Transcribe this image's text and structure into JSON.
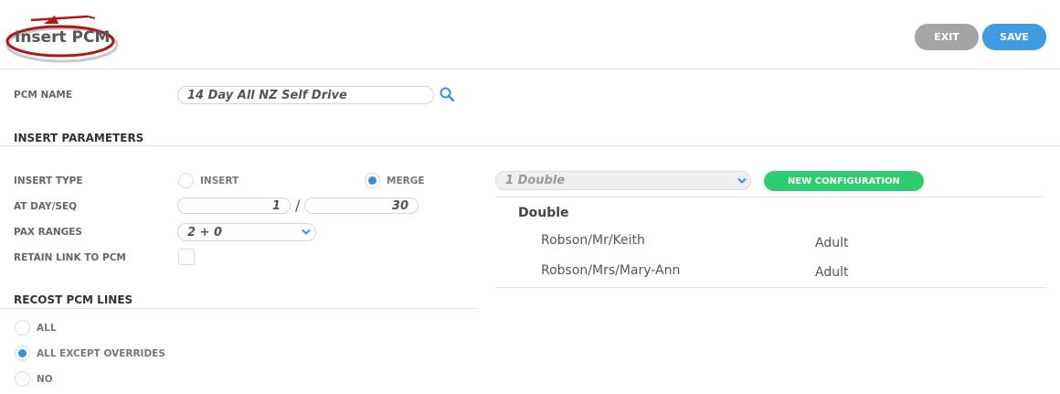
{
  "header": {
    "title": "Insert PCM",
    "exit_label": "EXIT",
    "save_label": "SAVE"
  },
  "pcm_name": {
    "label": "PCM NAME",
    "value": "14 Day All NZ Self Drive"
  },
  "insert_parameters": {
    "heading": "INSERT PARAMETERS",
    "insert_type": {
      "label": "INSERT TYPE",
      "options": [
        {
          "label": "INSERT",
          "selected": false
        },
        {
          "label": "MERGE",
          "selected": true
        }
      ]
    },
    "at_day_seq": {
      "label": "AT DAY/SEQ",
      "day": "1",
      "separator": "/",
      "seq": "30"
    },
    "pax_ranges": {
      "label": "PAX RANGES",
      "value": "2 + 0"
    },
    "retain_link": {
      "label": "RETAIN LINK TO PCM",
      "checked": false
    }
  },
  "recost": {
    "heading": "RECOST PCM LINES",
    "options": [
      {
        "label": "ALL",
        "selected": false
      },
      {
        "label": "ALL EXCEPT OVERRIDES",
        "selected": true
      },
      {
        "label": "NO",
        "selected": false
      }
    ]
  },
  "configuration": {
    "selected": "1 Double",
    "new_button_label": "NEW CONFIGURATION",
    "room_type": "Double",
    "passengers": [
      {
        "name": "Robson/Mr/Keith",
        "type": "Adult"
      },
      {
        "name": "Robson/Mrs/Mary-Ann",
        "type": "Adult"
      }
    ]
  },
  "colors": {
    "accent_blue": "#3e9be0",
    "exit_grey": "#a3a5a7",
    "new_config_green": "#2ecc71",
    "annotation_red": "#b01818"
  }
}
